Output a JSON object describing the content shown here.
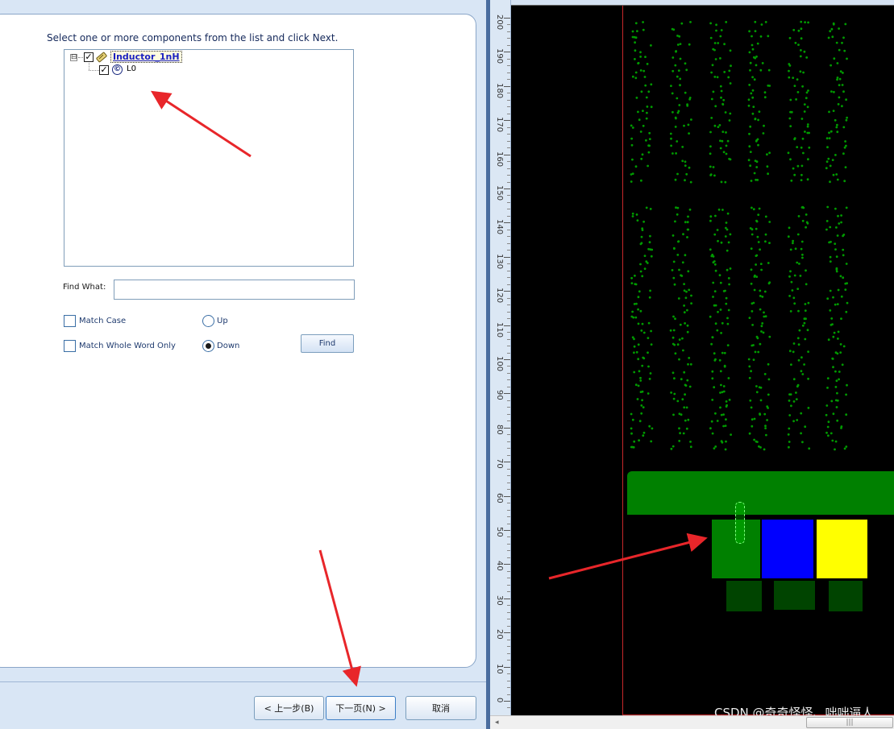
{
  "wizard": {
    "instruction": "Select one or more components from the list and click Next.",
    "tree": {
      "design_name": "Inductor_1nH",
      "design_expander": "⊟",
      "design_checked": "✓",
      "component_name": "L0",
      "component_checked": "✓",
      "component_icon": "©"
    },
    "find_what_label": "Find What:",
    "find_what_value": "",
    "match_case_label": "Match Case",
    "match_whole_word_label": "Match Whole Word Only",
    "direction_up_label": "Up",
    "direction_down_label": "Down",
    "direction_selected": "Down",
    "find_button_label": "Find",
    "back_button_label": "< 上一步(B)",
    "next_button_label": "下一页(N) >",
    "cancel_button_label": "取消"
  },
  "layout": {
    "ruler_labels": [
      "200",
      "190",
      "180",
      "170",
      "160",
      "150",
      "140",
      "130",
      "120",
      "110",
      "100",
      "90",
      "80",
      "70",
      "60",
      "50",
      "40",
      "30",
      "20",
      "10",
      "0"
    ],
    "colors": {
      "background": "#000000",
      "boundary": "#c8282a",
      "ground_plane": "#008000",
      "via": "#009a00",
      "pad_green": "#008000",
      "pad_blue": "#0000ff",
      "pad_yellow": "#ffff00",
      "pad_dark": "#004400"
    },
    "watermark": "CSDN @奇奇怪怪、咄咄逼人"
  },
  "annotations": {
    "arrow_color": "#e8262a",
    "icons": [
      "tree-expander-icon",
      "inductor-icon",
      "component-icon",
      "radio-icon",
      "checkbox-icon"
    ]
  }
}
